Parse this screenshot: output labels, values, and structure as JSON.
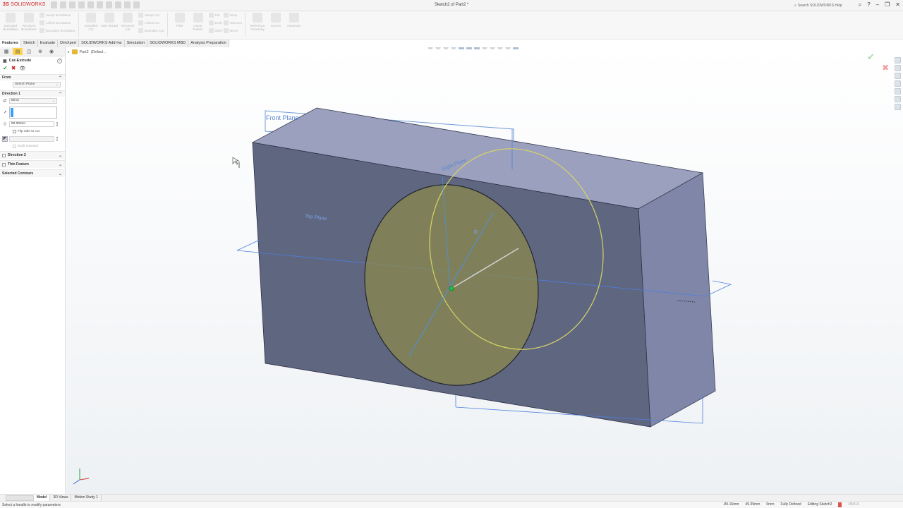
{
  "app": {
    "logo_ds": "3S",
    "logo_name": "SOLIDWORKS",
    "window_title": "Sketch2 of Part2 *",
    "search_placeholder": "Search SOLIDWORKS Help",
    "accent": "#d42b2b"
  },
  "ribbon": {
    "buttons": [
      {
        "label": "Extruded Boss/Base",
        "icon": "extrude-boss-icon"
      },
      {
        "label": "Revolved Boss/Base",
        "icon": "revolve-boss-icon"
      },
      {
        "label": "Extruded Cut",
        "icon": "extrude-cut-icon"
      },
      {
        "label": "Hole Wizard",
        "icon": "hole-wizard-icon"
      },
      {
        "label": "Revolved Cut",
        "icon": "revolve-cut-icon"
      },
      {
        "label": "Fillet",
        "icon": "fillet-icon"
      },
      {
        "label": "Linear Pattern",
        "icon": "linear-pattern-icon"
      },
      {
        "label": "Reference Geometry",
        "icon": "ref-geometry-icon"
      },
      {
        "label": "Curves",
        "icon": "curves-icon"
      },
      {
        "label": "Instant3D",
        "icon": "instant3d-icon"
      }
    ],
    "small_boss": [
      "Swept Boss/Base",
      "Lofted Boss/Base",
      "Boundary Boss/Base"
    ],
    "small_cut": [
      "Swept Cut",
      "Lofted Cut",
      "Boundary Cut"
    ],
    "small_features": [
      "Rib",
      "Draft",
      "Shell"
    ],
    "small_features2": [
      "Wrap",
      "Intersect",
      "Mirror"
    ]
  },
  "cm_tabs": [
    "Features",
    "Sketch",
    "Evaluate",
    "DimXpert",
    "SOLIDWORKS Add-Ins",
    "Simulation",
    "SOLIDWORKS MBD",
    "Analysis Preparation"
  ],
  "property_manager": {
    "title": "Cut-Extrude",
    "help": "?",
    "from_label": "From",
    "from_value": "Sketch Plane",
    "direction1_label": "Direction 1",
    "end_condition": "Blind",
    "depth_value": "50.00mm",
    "flip_label": "Flip side to cut",
    "draft_label": "Draft outward",
    "direction2_label": "Direction 2",
    "thin_label": "Thin Feature",
    "contours_label": "Selected Contours"
  },
  "graphics": {
    "tree_part": "Part2",
    "tree_config": "(Defaul...",
    "plane_front": "Front Plane",
    "plane_right": "Right Plane",
    "plane_top": "Top Plane",
    "dim_label": "Ø",
    "confirm_ok_icon": "check-icon",
    "confirm_cancel_icon": "x-icon"
  },
  "bottom_tabs": [
    "Model",
    "3D Views",
    "Motion Study 1"
  ],
  "status": {
    "message": "Select a handle to modify parameters",
    "x": "-85.16mm",
    "y": "49.39mm",
    "z": "0mm",
    "state": "Fully Defined",
    "editing": "Editing Sketch2",
    "units": "MMGS"
  }
}
